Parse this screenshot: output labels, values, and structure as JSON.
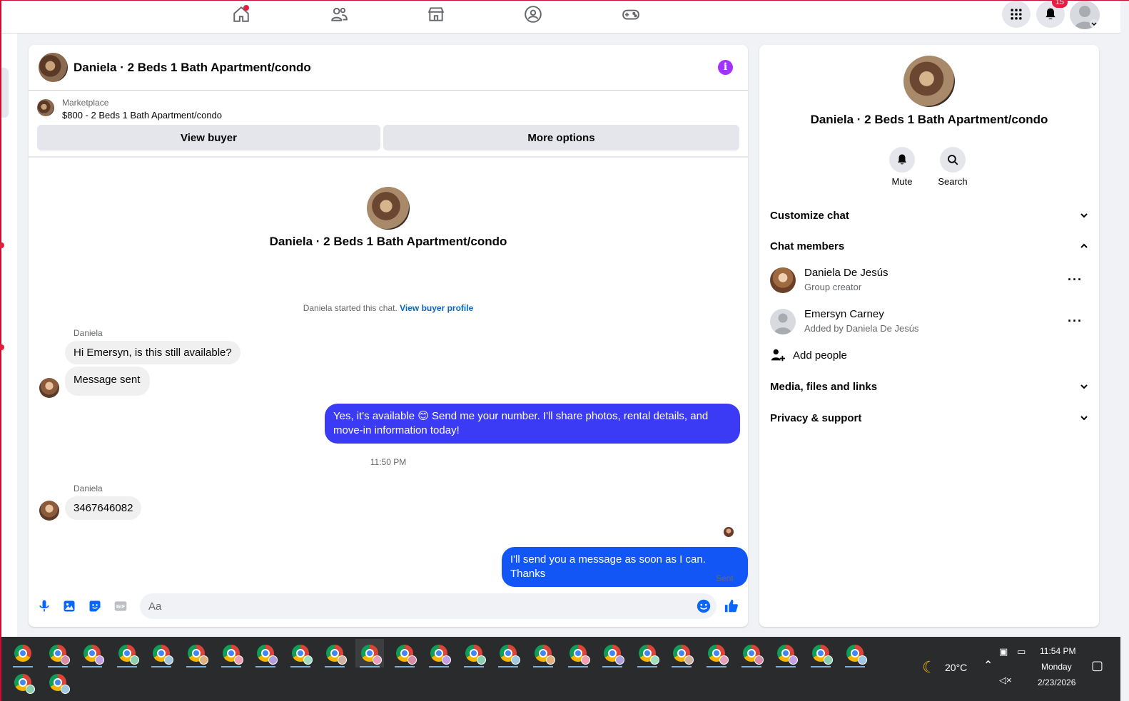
{
  "nav": {
    "icons": [
      "home-icon",
      "friends-icon",
      "marketplace-icon",
      "groups-icon",
      "gaming-icon"
    ],
    "notifications_count": "15"
  },
  "chat": {
    "title": "Daniela · 2 Beds 1 Bath Apartment/condo",
    "marketplace_label": "Marketplace",
    "listing": "$800 - 2 Beds 1 Bath Apartment/condo",
    "view_buyer": "View buyer",
    "more_options": "More options",
    "center_title": "Daniela · 2 Beds 1 Bath Apartment/condo",
    "started_text": "Daniela started this chat.",
    "view_buyer_profile": "View buyer profile",
    "messages": [
      {
        "sender": "Daniela",
        "text": "Hi Emersyn, is this still available?"
      },
      {
        "text": "Message sent"
      },
      {
        "text": "Yes, it's available 😊 Send me your number. I'll share photos, rental details, and move-in information today!"
      },
      {
        "time": "11:50 PM"
      },
      {
        "sender": "Daniela",
        "text": "3467646082"
      },
      {
        "text": "I'll send you a message as soon as I can. Thanks"
      }
    ],
    "sent_status": "Sent",
    "composer_placeholder": "Aa",
    "out_color_1": "#3b3bf5",
    "out_color_2": "#1257f5"
  },
  "details": {
    "title": "Daniela · 2 Beds 1 Bath Apartment/condo",
    "mute": "Mute",
    "search": "Search",
    "customize_chat": "Customize chat",
    "chat_members": "Chat members",
    "members": [
      {
        "name": "Daniela De Jesús",
        "role": "Group creator"
      },
      {
        "name": "Emersyn Carney",
        "role": "Added by Daniela De Jesús"
      }
    ],
    "add_people": "Add people",
    "media": "Media, files and links",
    "privacy": "Privacy & support"
  },
  "taskbar": {
    "weather": "20°C",
    "time": "11:54 PM",
    "day": "Monday",
    "date": "2/23/2026"
  }
}
